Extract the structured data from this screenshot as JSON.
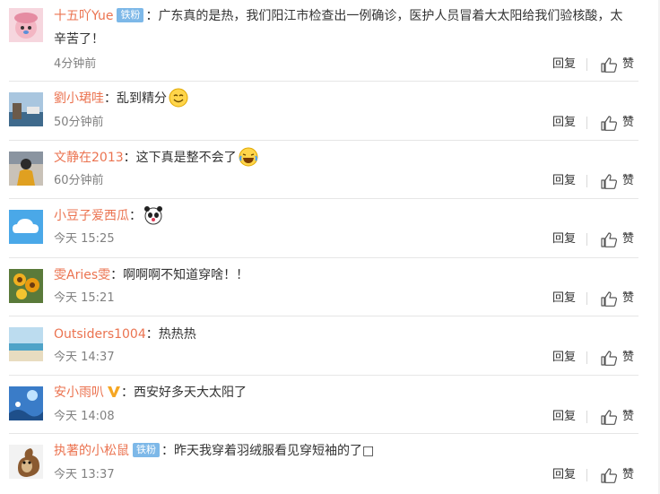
{
  "comments": [
    {
      "user": "十五吖Yue",
      "badge": "铁粉",
      "vip": false,
      "colon": "：",
      "text": "广东真的是热，我们阳江市检查出一例确诊，医护人员冒着大太阳给我们验核酸，太辛苦了！",
      "emoji": "",
      "time": "4分钟前",
      "reply": "回复",
      "like": "赞",
      "avatar": "avatar-pink-cartoon"
    },
    {
      "user": "劉小珺哇",
      "badge": "",
      "vip": false,
      "colon": "：",
      "text": "乱到精分",
      "emoji": "smile-face",
      "time": "50分钟前",
      "reply": "回复",
      "like": "赞",
      "avatar": "avatar-seaside-photo"
    },
    {
      "user": "文静在2013",
      "badge": "",
      "vip": false,
      "colon": "：",
      "text": "这下真是整不会了",
      "emoji": "laugh-tears-face",
      "time": "60分钟前",
      "reply": "回复",
      "like": "赞",
      "avatar": "avatar-person-photo"
    },
    {
      "user": "小豆子爱西瓜",
      "badge": "",
      "vip": false,
      "colon": "：",
      "text": "",
      "emoji": "panda-face",
      "time": "今天 15:25",
      "reply": "回复",
      "like": "赞",
      "avatar": "avatar-blue-cloud"
    },
    {
      "user": "雯Aries雯",
      "badge": "",
      "vip": false,
      "colon": "：",
      "text": "啊啊啊不知道穿啥！！",
      "emoji": "",
      "time": "今天 15:21",
      "reply": "回复",
      "like": "赞",
      "avatar": "avatar-sunflower-painting"
    },
    {
      "user": "Outsiders1004",
      "badge": "",
      "vip": false,
      "colon": "：",
      "text": "热热热",
      "emoji": "",
      "time": "今天 14:37",
      "reply": "回复",
      "like": "赞",
      "avatar": "avatar-beach-photo"
    },
    {
      "user": "安小雨叭",
      "badge": "",
      "vip": true,
      "colon": "：",
      "text": "西安好多天大太阳了",
      "emoji": "",
      "time": "今天 14:08",
      "reply": "回复",
      "like": "赞",
      "avatar": "avatar-anime-sky"
    },
    {
      "user": "执著的小松鼠",
      "badge": "铁粉",
      "vip": false,
      "colon": "：",
      "text": "昨天我穿着羽绒服看见穿短袖的了□",
      "emoji": "",
      "time": "今天 13:37",
      "reply": "回复",
      "like": "赞",
      "avatar": "avatar-squirrel"
    }
  ],
  "colors": {
    "username": "#eb7350",
    "badge": "#7db8e8",
    "vip": "#f5a623",
    "time": "#808080"
  }
}
